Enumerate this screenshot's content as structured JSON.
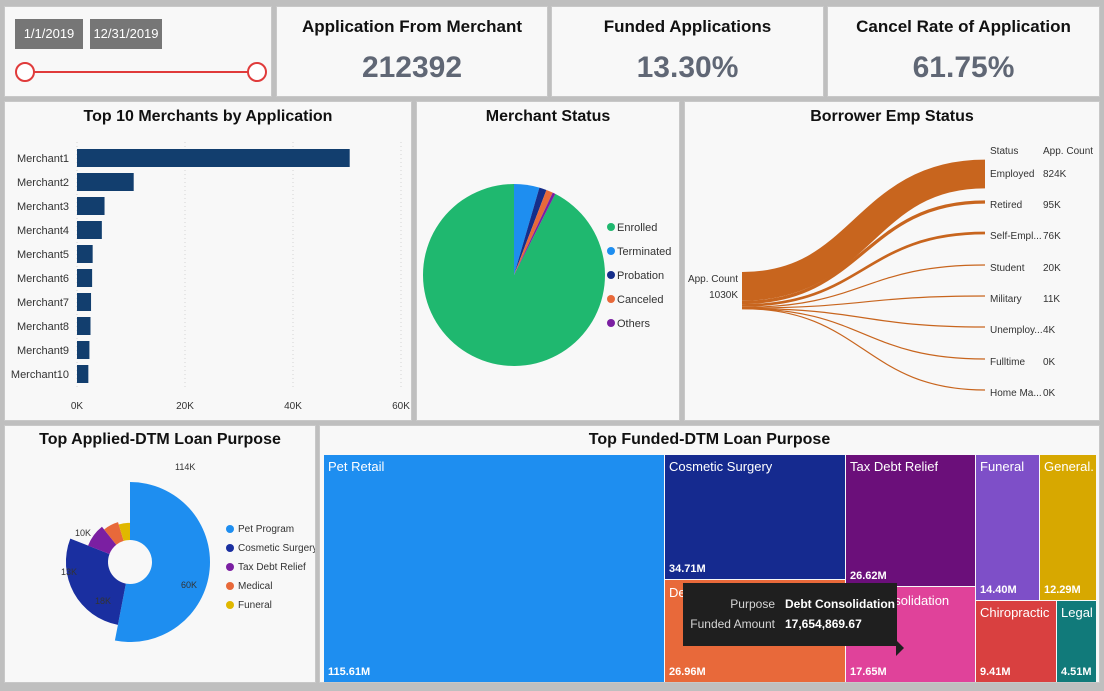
{
  "filter": {
    "start_date": "1/1/2019",
    "end_date": "12/31/2019",
    "slider_color": "#e03b3b"
  },
  "kpis": [
    {
      "title": "Application From Merchant",
      "value": "212392"
    },
    {
      "title": "Funded Applications",
      "value": "13.30%"
    },
    {
      "title": "Cancel Rate of Application",
      "value": "61.75%"
    }
  ],
  "top_merchants": {
    "title": "Top 10 Merchants by Application",
    "color": "#123e6e",
    "chart_data": {
      "type": "bar",
      "orientation": "horizontal",
      "categories": [
        "Merchant1",
        "Merchant2",
        "Merchant3",
        "Merchant4",
        "Merchant5",
        "Merchant6",
        "Merchant7",
        "Merchant8",
        "Merchant9",
        "Merchant10"
      ],
      "values": [
        50500,
        10500,
        5100,
        4600,
        2900,
        2800,
        2600,
        2500,
        2300,
        2100
      ],
      "xlim": [
        0,
        60000
      ],
      "xticks": [
        "0K",
        "20K",
        "40K",
        "60K"
      ],
      "grid": true
    }
  },
  "merchant_status": {
    "title": "Merchant Status",
    "chart_data": {
      "type": "pie",
      "legend_position": "right",
      "slices": [
        {
          "label": "Enrolled",
          "value": 92.5,
          "color": "#1fb86f"
        },
        {
          "label": "Terminated",
          "value": 4.5,
          "color": "#1e8ef0"
        },
        {
          "label": "Probation",
          "value": 1.3,
          "color": "#152e8a"
        },
        {
          "label": "Canceled",
          "value": 1.2,
          "color": "#e8693a"
        },
        {
          "label": "Others",
          "value": 0.5,
          "color": "#7b1fa2"
        }
      ]
    }
  },
  "borrower_emp": {
    "title": "Borrower Emp Status",
    "color": "#c8651e",
    "header_status": "Status",
    "header_count": "App. Count",
    "source_label": "App. Count",
    "source_value": "1030K",
    "rows": [
      {
        "status": "Employed",
        "count": "824K"
      },
      {
        "status": "Retired",
        "count": "95K"
      },
      {
        "status": "Self-Empl...",
        "count": "76K"
      },
      {
        "status": "Student",
        "count": "20K"
      },
      {
        "status": "Military",
        "count": "11K"
      },
      {
        "status": "Unemploy...",
        "count": "4K"
      },
      {
        "status": "Fulltime",
        "count": "0K"
      },
      {
        "status": "Home Ma...",
        "count": "0K"
      }
    ],
    "chart_data": {
      "type": "sankey",
      "source": "App. Count",
      "source_total": 1030,
      "targets": [
        "Employed",
        "Retired",
        "Self-Empl...",
        "Student",
        "Military",
        "Unemploy...",
        "Fulltime",
        "Home Ma..."
      ],
      "values": [
        824,
        95,
        76,
        20,
        11,
        4,
        0,
        0
      ]
    }
  },
  "applied_purpose": {
    "title": "Top Applied-DTM Loan Purpose",
    "chart_data": {
      "type": "pie",
      "variant": "rose-donut",
      "legend_position": "right",
      "slices": [
        {
          "label": "Pet Program",
          "value": 114,
          "display": "114K",
          "color": "#1e8ef0"
        },
        {
          "label": "Cosmetic Surgery",
          "value": 60,
          "display": "60K",
          "color": "#1a2fa0"
        },
        {
          "label": "Tax Debt Relief",
          "value": 18,
          "display": "18K",
          "color": "#7b1fa2"
        },
        {
          "label": "Medical",
          "value": 13,
          "display": "13K",
          "color": "#e8693a"
        },
        {
          "label": "Funeral",
          "value": 10,
          "display": "10K",
          "color": "#e0b800"
        }
      ]
    }
  },
  "funded_purpose": {
    "title": "Top Funded-DTM Loan Purpose",
    "chart_data": {
      "type": "treemap",
      "items": [
        {
          "label": "Pet Retail",
          "value": 115.61,
          "display": "115.61M",
          "color": "#1e8ef0"
        },
        {
          "label": "Cosmetic Surgery",
          "value": 34.71,
          "display": "34.71M",
          "color": "#152a8f"
        },
        {
          "label": "Tax Debt Relief",
          "value": 26.62,
          "display": "26.62M",
          "color": "#6b0f7a"
        },
        {
          "label": "Debt Consolidation",
          "value": 26.96,
          "display": "26.96M",
          "color": "#e8693a"
        },
        {
          "label": "Debt Consolidation",
          "value": 17.65,
          "display": "17.65M",
          "color": "#e0429a"
        },
        {
          "label": "Funeral",
          "value": 14.4,
          "display": "14.40M",
          "color": "#7e4fc8"
        },
        {
          "label": "General...",
          "value": 12.29,
          "display": "12.29M",
          "color": "#d7a800"
        },
        {
          "label": "Chiropractic",
          "value": 9.41,
          "display": "9.41M",
          "color": "#d94040"
        },
        {
          "label": "Legal",
          "value": 4.51,
          "display": "4.51M",
          "color": "#117a7a"
        }
      ],
      "partial_labels": {
        "debt_left": "De",
        "debt_right": "nsolidation"
      }
    },
    "tooltip": {
      "purpose_key": "Purpose",
      "purpose_value": "Debt Consolidation",
      "amount_key": "Funded Amount",
      "amount_value": "17,654,869.67"
    }
  }
}
